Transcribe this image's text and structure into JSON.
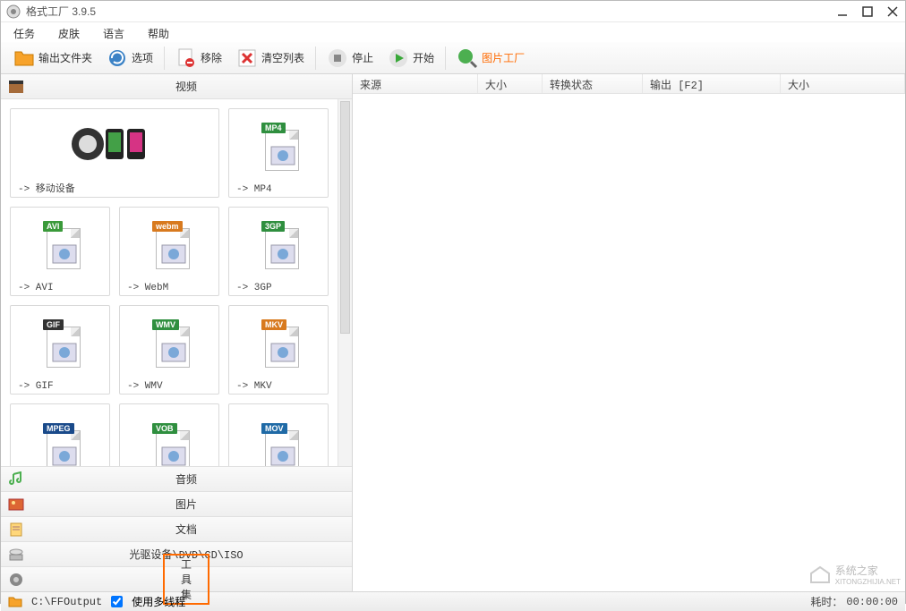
{
  "title": "格式工厂 3.9.5",
  "menu": {
    "tasks": "任务",
    "skin": "皮肤",
    "language": "语言",
    "help": "帮助"
  },
  "toolbar": {
    "output_folder": "输出文件夹",
    "options": "选项",
    "remove": "移除",
    "clear_list": "清空列表",
    "stop": "停止",
    "start": "开始",
    "pic_factory": "图片工厂"
  },
  "categories": {
    "video": "视频",
    "audio": "音频",
    "image": "图片",
    "document": "文档",
    "disc": "光驱设备\\DVD\\CD\\ISO",
    "tools": "工具集"
  },
  "formats": [
    {
      "label": "-> 移动设备",
      "wide": true,
      "badge": "",
      "color": "#444"
    },
    {
      "label": "-> MP4",
      "badge": "MP4",
      "color": "#2f8f3f"
    },
    {
      "label": "-> AVI",
      "badge": "AVI",
      "color": "#3a9a3a"
    },
    {
      "label": "-> WebM",
      "badge": "webm",
      "color": "#d87a1f"
    },
    {
      "label": "-> 3GP",
      "badge": "3GP",
      "color": "#2f8f3f"
    },
    {
      "label": "-> GIF",
      "badge": "GIF",
      "color": "#333"
    },
    {
      "label": "-> WMV",
      "badge": "WMV",
      "color": "#2f8f3f"
    },
    {
      "label": "-> MKV",
      "badge": "MKV",
      "color": "#d87a1f"
    },
    {
      "label": "",
      "badge": "MPEG",
      "color": "#1a4a8a"
    },
    {
      "label": "",
      "badge": "VOB",
      "color": "#2f8f3f"
    },
    {
      "label": "",
      "badge": "MOV",
      "color": "#1f6aa6"
    }
  ],
  "columns": {
    "source": "来源",
    "size": "大小",
    "status": "转换状态",
    "output": "输出 [F2]",
    "size2": "大小"
  },
  "status": {
    "path": "C:\\FFOutput",
    "multithread": "使用多线程",
    "elapsed_label": "耗时：",
    "elapsed_value": "00:00:00"
  },
  "watermark": {
    "text": "系统之家",
    "url": "XITONGZHIJIA.NET"
  }
}
